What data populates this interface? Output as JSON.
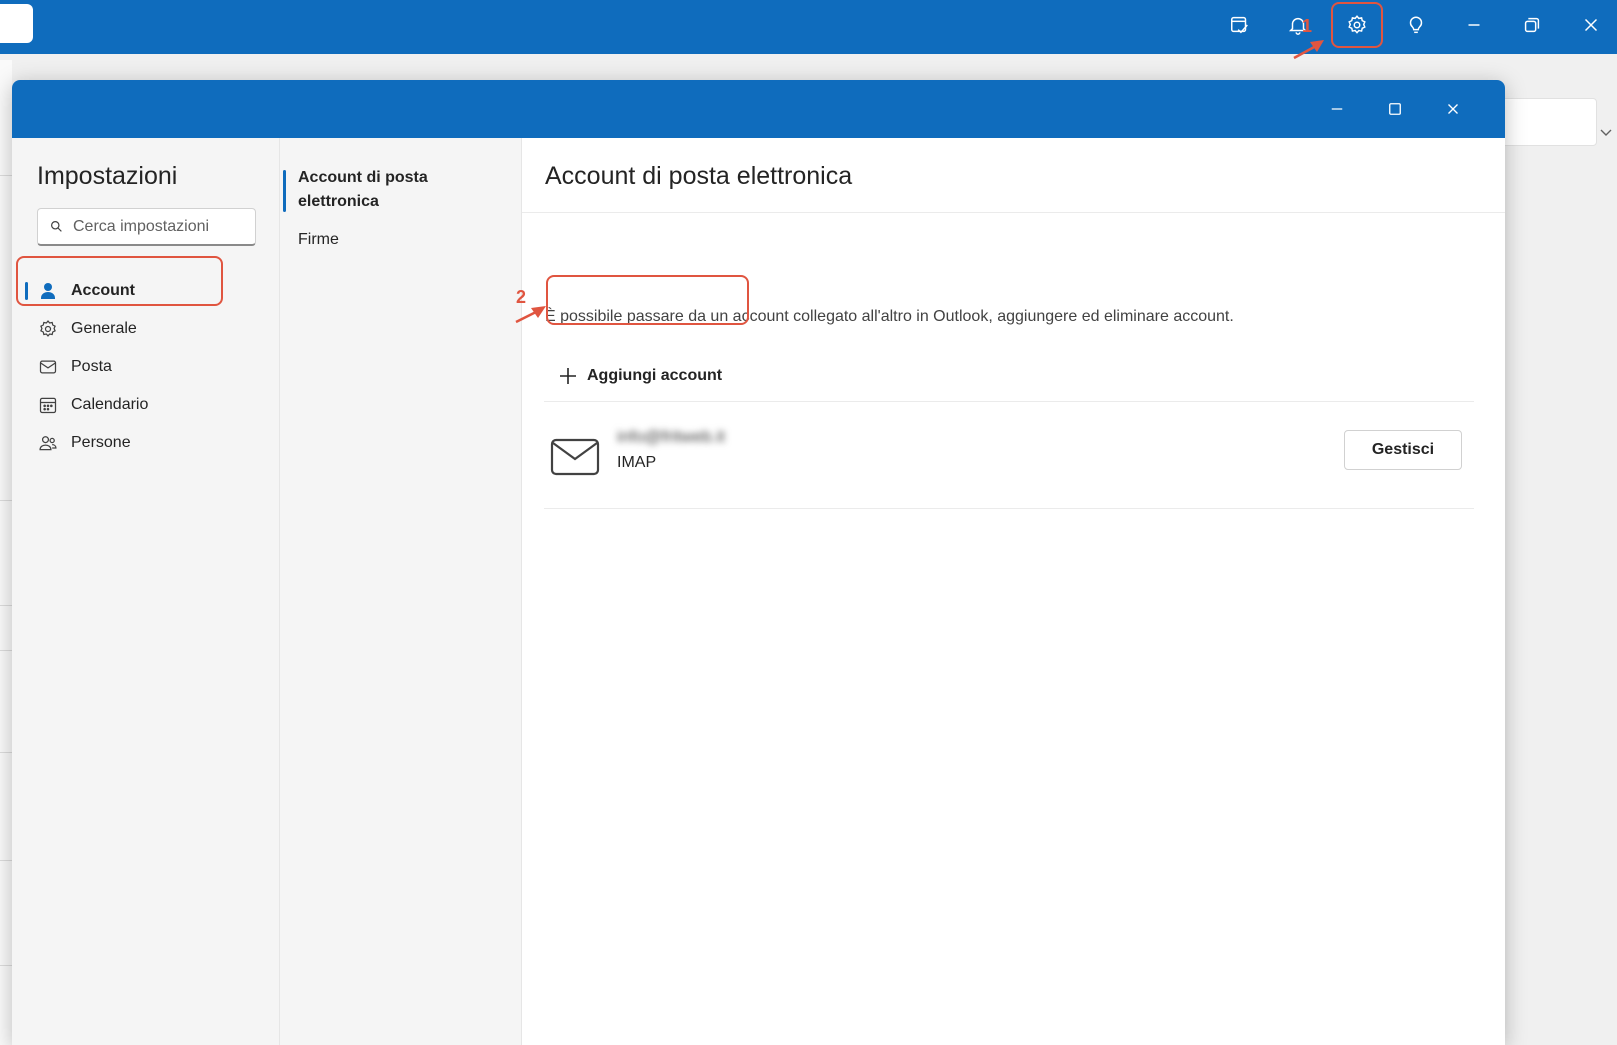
{
  "appbar": {
    "buttons": [
      {
        "name": "my-day-button",
        "icon": "my-day-icon"
      },
      {
        "name": "notifications-button",
        "icon": "bell-icon"
      },
      {
        "name": "settings-button",
        "icon": "gear-icon"
      },
      {
        "name": "tips-button",
        "icon": "lightbulb-icon"
      },
      {
        "name": "minimize-button",
        "icon": "minimize-icon"
      },
      {
        "name": "restore-button",
        "icon": "restore-icon"
      },
      {
        "name": "close-button",
        "icon": "close-icon"
      }
    ]
  },
  "settings": {
    "title": "Impostazioni",
    "search_placeholder": "Cerca impostazioni",
    "nav": [
      {
        "label": "Account",
        "icon": "person-icon",
        "active": true
      },
      {
        "label": "Generale",
        "icon": "gear-icon",
        "active": false
      },
      {
        "label": "Posta",
        "icon": "mail-icon",
        "active": false
      },
      {
        "label": "Calendario",
        "icon": "calendar-icon",
        "active": false
      },
      {
        "label": "Persone",
        "icon": "people-icon",
        "active": false
      }
    ],
    "subnav": [
      {
        "label": "Account di posta elettronica",
        "active": true
      },
      {
        "label": "Firme",
        "active": false
      }
    ]
  },
  "content": {
    "title": "Account di posta elettronica",
    "description": "È possibile passare da un account collegato all'altro in Outlook, aggiungere ed eliminare account.",
    "add_account_label": "Aggiungi account",
    "accounts": [
      {
        "email": "info@fritweb.it",
        "type": "IMAP",
        "manage_label": "Gestisci"
      }
    ]
  },
  "annotations": [
    {
      "number": "1",
      "target": "settings-button"
    },
    {
      "number": "2",
      "target": "add-account-button"
    }
  ],
  "colors": {
    "brand": "#0f6cbd",
    "annotation": "#e05540"
  }
}
